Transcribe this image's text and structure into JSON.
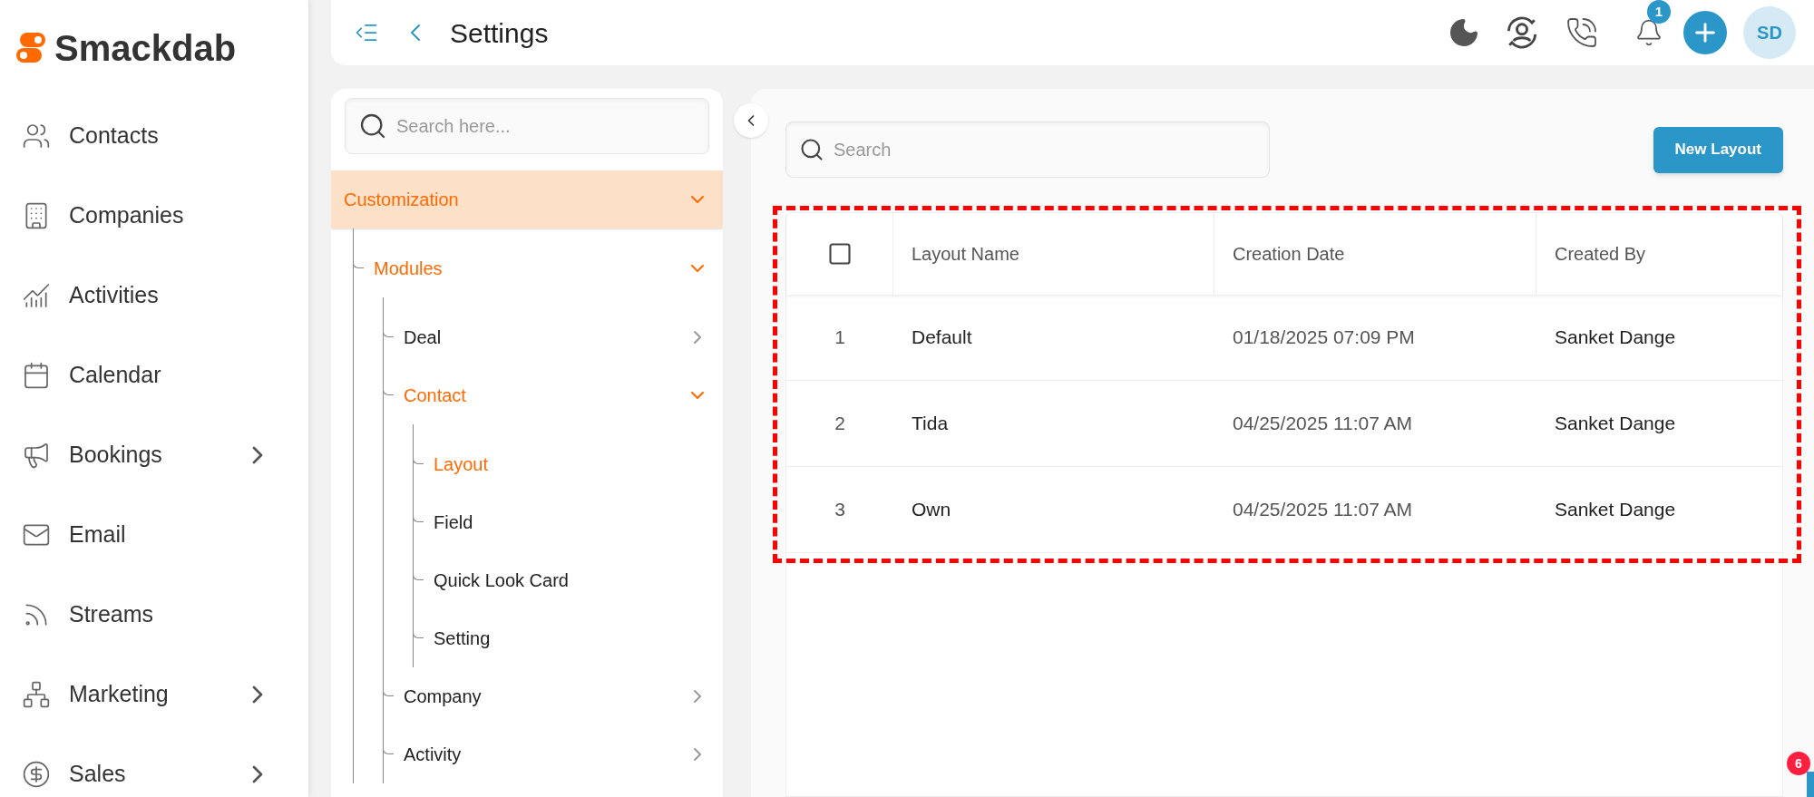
{
  "brand": {
    "name": "Smackdab"
  },
  "sidebar": {
    "items": [
      {
        "label": "Contacts",
        "has_submenu": false
      },
      {
        "label": "Companies",
        "has_submenu": false
      },
      {
        "label": "Activities",
        "has_submenu": false
      },
      {
        "label": "Calendar",
        "has_submenu": false
      },
      {
        "label": "Bookings",
        "has_submenu": true
      },
      {
        "label": "Email",
        "has_submenu": false
      },
      {
        "label": "Streams",
        "has_submenu": false
      },
      {
        "label": "Marketing",
        "has_submenu": true
      },
      {
        "label": "Sales",
        "has_submenu": true
      }
    ]
  },
  "header": {
    "title": "Settings",
    "notification_count": "1",
    "avatar_initials": "SD"
  },
  "settings_tree": {
    "search_placeholder": "Search here...",
    "items": [
      {
        "label": "Customization",
        "expanded": true,
        "active": true,
        "children": [
          {
            "label": "Modules",
            "expanded": true,
            "active": true,
            "children": [
              {
                "label": "Deal",
                "expanded": false,
                "active": false
              },
              {
                "label": "Contact",
                "expanded": true,
                "active": true,
                "children": [
                  {
                    "label": "Layout",
                    "active": true
                  },
                  {
                    "label": "Field",
                    "active": false
                  },
                  {
                    "label": "Quick Look Card",
                    "active": false
                  },
                  {
                    "label": "Setting",
                    "active": false
                  }
                ]
              },
              {
                "label": "Company",
                "expanded": false,
                "active": false
              },
              {
                "label": "Activity",
                "expanded": false,
                "active": false
              }
            ]
          }
        ]
      }
    ]
  },
  "layouts": {
    "search_placeholder": "Search",
    "new_button": "New Layout",
    "table": {
      "select_all_checked": false,
      "columns": [
        "Layout Name",
        "Creation Date",
        "Created By"
      ],
      "rows": [
        {
          "index": "1",
          "cells": [
            "Default",
            "01/18/2025 07:09 PM",
            "Sanket Dange"
          ]
        },
        {
          "index": "2",
          "cells": [
            "Tida",
            "04/25/2025 11:07 AM",
            "Sanket Dange"
          ]
        },
        {
          "index": "3",
          "cells": [
            "Own",
            "04/25/2025 11:07 AM",
            "Sanket Dange"
          ]
        }
      ]
    }
  },
  "floating_badge": {
    "count": "6"
  }
}
